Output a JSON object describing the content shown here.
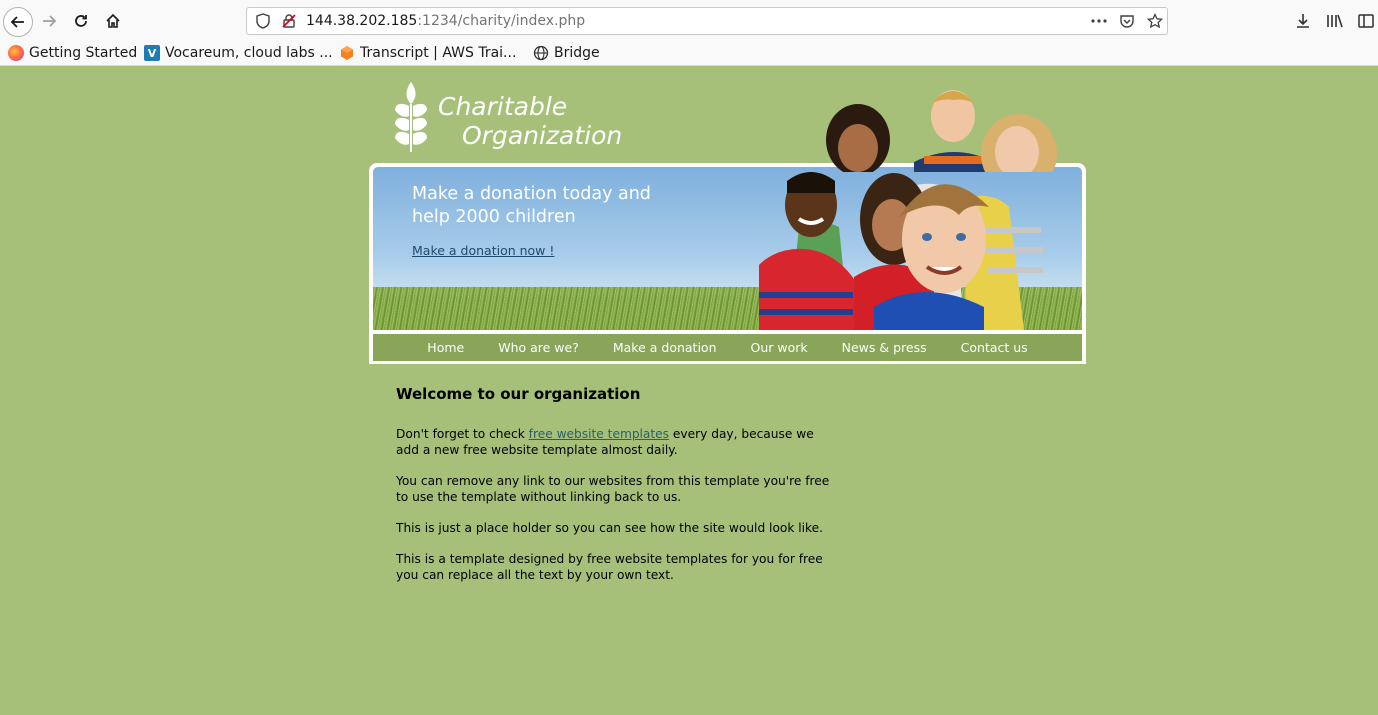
{
  "browser": {
    "url_host": "144.38.202.185",
    "url_path": ":1234/charity/index.php",
    "bookmarks": [
      {
        "label": "Getting Started",
        "icon": "firefox-icon"
      },
      {
        "label": "Vocareum, cloud labs ...",
        "icon": "vocareum-icon"
      },
      {
        "label": "Transcript | AWS Trai...",
        "icon": "aws-icon"
      },
      {
        "label": "Bridge",
        "icon": "globe-icon"
      }
    ]
  },
  "logo": {
    "line1": "Charitable",
    "line2": "Organization"
  },
  "banner": {
    "title": "Make a donation today and help 2000 children",
    "link": "Make a donation now !"
  },
  "menu": [
    "Home",
    "Who are we?",
    "Make a donation",
    "Our work",
    "News & press",
    "Contact us"
  ],
  "content": {
    "heading": "Welcome to our organization",
    "p1_before": "Don't forget to check ",
    "p1_link": "free website templates",
    "p1_after": " every day, because we add a new free website template almost daily.",
    "p2": "You can remove any link to our websites from this template you're free to use the template without linking back to us.",
    "p3": "This is just a place holder so you can see how the site would look like.",
    "p4": "This is a template designed by free website templates for you for free you can replace all the text by your own text."
  },
  "colors": {
    "page_bg": "#a6c07a",
    "menu_bg": "#88a55a",
    "link": "#2d5f63"
  }
}
